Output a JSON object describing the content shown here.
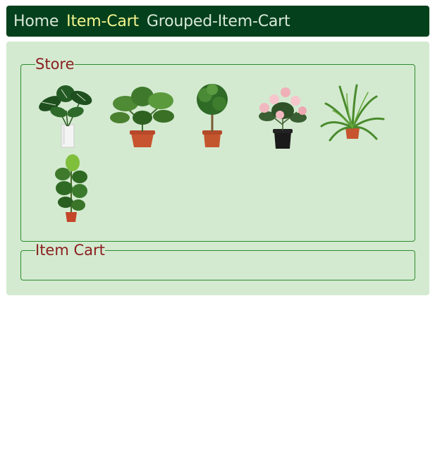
{
  "nav": {
    "home": "Home",
    "item_cart": "Item-Cart",
    "grouped_item_cart": "Grouped-Item-Cart"
  },
  "store": {
    "legend": "Store",
    "items": [
      {
        "icon": "monstera-plant-icon"
      },
      {
        "icon": "fatsia-plant-icon"
      },
      {
        "icon": "ficus-tree-plant-icon"
      },
      {
        "icon": "rose-plant-icon"
      },
      {
        "icon": "fern-plant-icon"
      },
      {
        "icon": "fiddle-leaf-fig-plant-icon"
      }
    ]
  },
  "cart": {
    "legend": "Item Cart"
  },
  "colors": {
    "navbar": "#03401b",
    "nav_text": "#d8e8d8",
    "nav_active": "#f5f590",
    "panel": "#d3ead0",
    "legend": "#8b2020",
    "border": "#2e8b2e"
  }
}
